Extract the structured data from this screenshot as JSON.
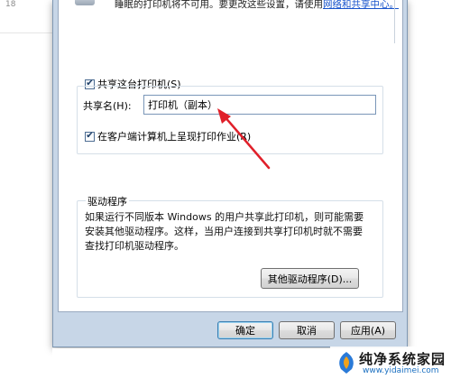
{
  "background": {
    "fragment_text": "18"
  },
  "dialog": {
    "top_note": "睡眠的打印机将不可用。要更改这些设置，请使用",
    "top_note_link": "网络和共享中心。",
    "share_checkbox": {
      "label": "共享这台打印机(S)",
      "checked": true
    },
    "share_name": {
      "label": "共享名(H):",
      "value": "打印机（副本）"
    },
    "render_checkbox": {
      "label": "在客户端计算机上呈现打印作业(R)",
      "checked": true
    },
    "drivers": {
      "title": "驱动程序",
      "description": "如果运行不同版本 Windows 的用户共享此打印机，则可能需要安装其他驱动程序。这样，当用户连接到共享打印机时就不需要查找打印机驱动程序。",
      "button_label": "其他驱动程序(D)..."
    },
    "buttons": {
      "ok": "确定",
      "cancel": "取消",
      "apply": "应用(A)"
    }
  },
  "annotation": {
    "arrow_color": "#e0202a"
  },
  "watermark": {
    "title": "纯净系统家园",
    "url": "www.yidaimei.com"
  },
  "colors": {
    "window_frame": "#c7d6e7",
    "link": "#1a55cc",
    "groupbox_border": "#d5dfe8"
  }
}
